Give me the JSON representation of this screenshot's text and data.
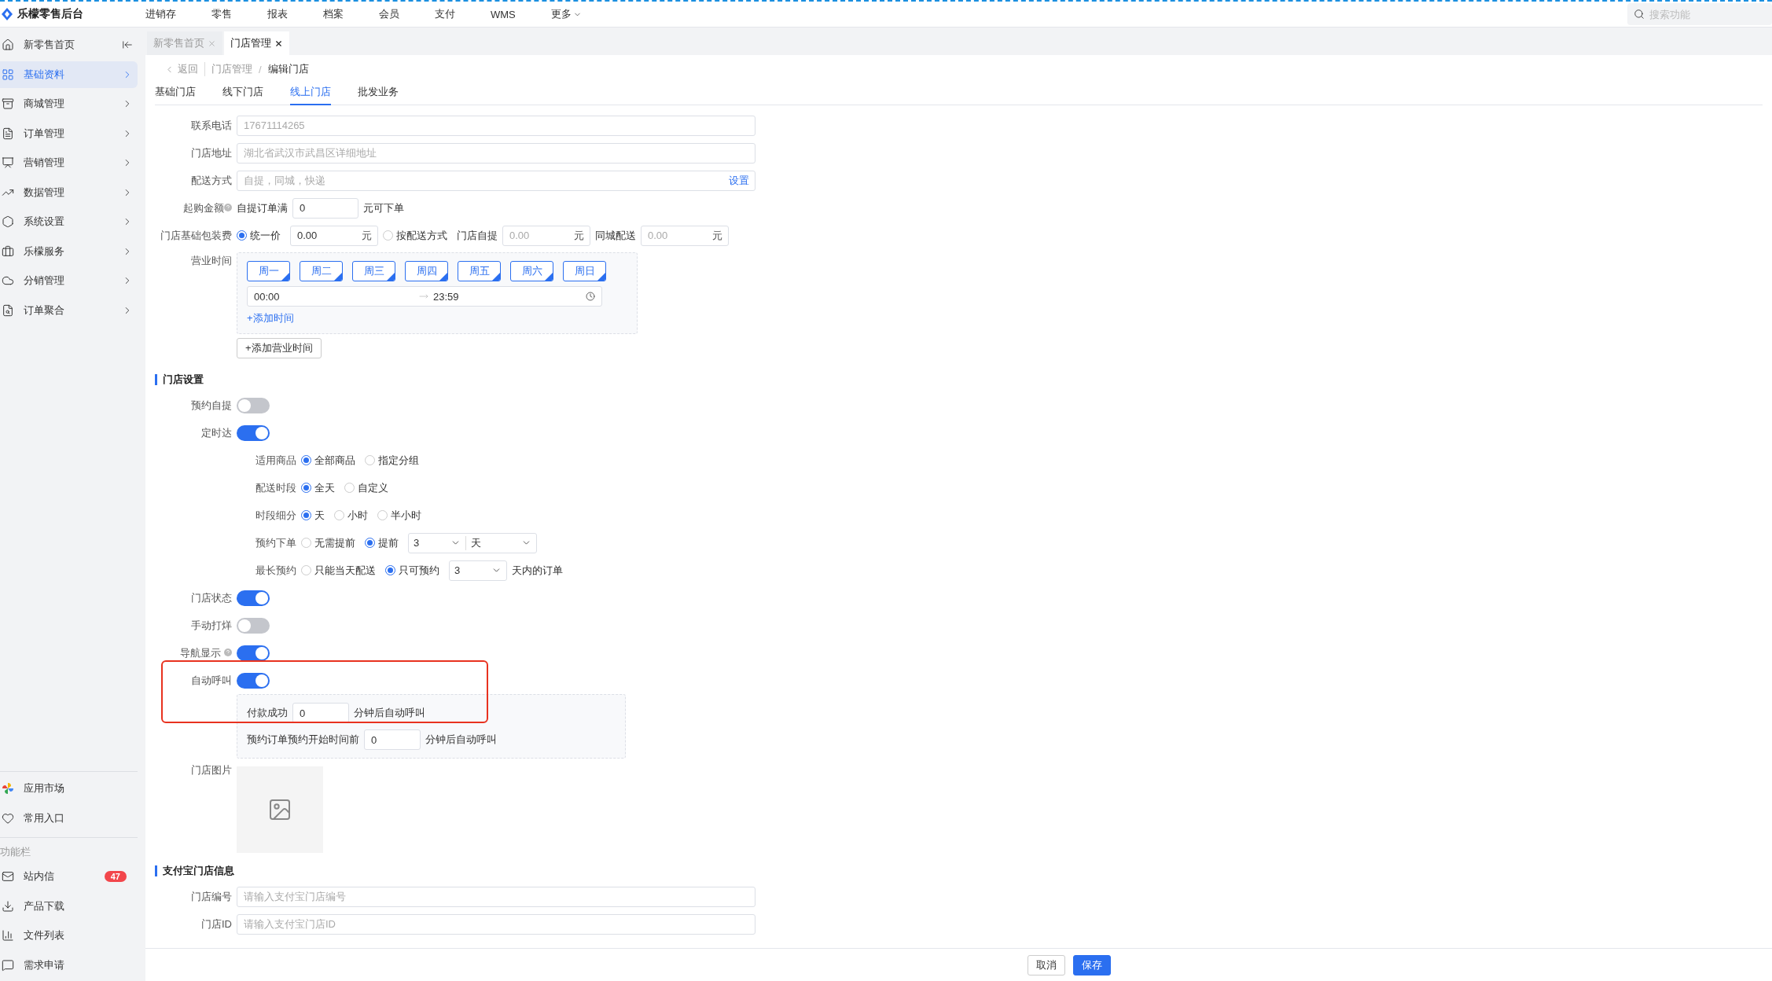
{
  "app": {
    "title": "乐檬零售后台"
  },
  "top_nav": {
    "items": [
      "进销存",
      "零售",
      "报表",
      "档案",
      "会员",
      "支付",
      "WMS"
    ],
    "more": "更多"
  },
  "search": {
    "placeholder": "搜索功能"
  },
  "sidebar": {
    "items": [
      {
        "label": "新零售首页",
        "selected": false
      },
      {
        "label": "基础资料",
        "selected": true
      },
      {
        "label": "商城管理",
        "selected": false
      },
      {
        "label": "订单管理",
        "selected": false
      },
      {
        "label": "营销管理",
        "selected": false
      },
      {
        "label": "数据管理",
        "selected": false
      },
      {
        "label": "系统设置",
        "selected": false
      },
      {
        "label": "乐檬服务",
        "selected": false
      },
      {
        "label": "分销管理",
        "selected": false
      },
      {
        "label": "订单聚合",
        "selected": false
      }
    ],
    "shortcuts": [
      "应用市场",
      "常用入口"
    ],
    "section_title": "功能栏",
    "tools": [
      {
        "label": "站内信",
        "badge": "47"
      },
      {
        "label": "产品下载"
      },
      {
        "label": "文件列表"
      },
      {
        "label": "需求申请"
      }
    ]
  },
  "page_tabs": [
    {
      "label": "新零售首页",
      "selected": false
    },
    {
      "label": "门店管理",
      "selected": true
    }
  ],
  "breadcrumb": {
    "back": "返回",
    "path": [
      "门店管理",
      "编辑门店"
    ],
    "separator": "/"
  },
  "tabs": [
    {
      "label": "基础门店",
      "selected": false
    },
    {
      "label": "线下门店",
      "selected": false
    },
    {
      "label": "线上门店",
      "selected": true
    },
    {
      "label": "批发业务",
      "selected": false
    }
  ],
  "fields": [
    {
      "label": "联系电话",
      "placeholder": "17671114265"
    },
    {
      "label": "门店地址",
      "placeholder": "湖北省武汉市武昌区详细地址"
    },
    {
      "label": "配送方式",
      "placeholder": "自提，同城，快递",
      "action": "设置"
    }
  ],
  "min_purchase": {
    "label": "起购金额",
    "prefix": "自提订单满",
    "value": "0",
    "suffix": "元可下单"
  },
  "packaging_fee": {
    "label": "门店基础包装费",
    "uniform": {
      "label": "统一价",
      "selected": true,
      "value": "0.00",
      "unit": "元"
    },
    "by_delivery": {
      "label": "按配送方式",
      "selected": false,
      "options": [
        {
          "label": "门店自提",
          "placeholder": "0.00",
          "unit": "元"
        },
        {
          "label": "同城配送",
          "placeholder": "0.00",
          "unit": "元"
        }
      ]
    }
  },
  "business_hours": {
    "label": "营业时间",
    "days": [
      {
        "label": "周一",
        "selected": true
      },
      {
        "label": "周二",
        "selected": true
      },
      {
        "label": "周三",
        "selected": true
      },
      {
        "label": "周四",
        "selected": true
      },
      {
        "label": "周五",
        "selected": true
      },
      {
        "label": "周六",
        "selected": true
      },
      {
        "label": "周日",
        "selected": true
      }
    ],
    "start": "00:00",
    "end": "23:59",
    "add_time": "+添加时间",
    "add_hours": "+添加营业时间"
  },
  "store_settings": {
    "title": "门店设置",
    "items": [
      {
        "kind": "switch",
        "label": "预约自提",
        "on": false
      },
      {
        "kind": "switch",
        "label": "定时达",
        "on": true
      },
      {
        "kind": "radio",
        "label": "适用商品",
        "options": [
          {
            "label": "全部商品",
            "selected": true
          },
          {
            "label": "指定分组",
            "selected": false
          }
        ]
      },
      {
        "kind": "radio",
        "label": "配送时段",
        "options": [
          {
            "label": "全天",
            "selected": true
          },
          {
            "label": "自定义",
            "selected": false
          }
        ]
      },
      {
        "kind": "radio",
        "label": "时段细分",
        "options": [
          {
            "label": "天",
            "selected": true
          },
          {
            "label": "小时",
            "selected": false
          },
          {
            "label": "半小时",
            "selected": false
          }
        ]
      },
      {
        "kind": "radio",
        "label": "预约下单",
        "options": [
          {
            "label": "无需提前",
            "selected": false
          },
          {
            "label": "提前",
            "selected": true
          }
        ],
        "selects": [
          "3",
          "天"
        ]
      },
      {
        "kind": "radio",
        "label": "最长预约",
        "options": [
          {
            "label": "只能当天配送",
            "selected": false
          },
          {
            "label": "只可预约",
            "selected": true
          }
        ],
        "selects": [
          "3"
        ],
        "suffix": "天内的订单"
      },
      {
        "kind": "switch",
        "label": "门店状态",
        "on": true
      },
      {
        "kind": "switch",
        "label": "手动打烊",
        "on": false
      },
      {
        "kind": "switch",
        "label": "导航显示",
        "on": true,
        "help": true
      },
      {
        "kind": "switch",
        "label": "自动呼叫",
        "on": true,
        "highlighted": true,
        "panel": [
          {
            "label": "付款成功",
            "value": "0",
            "suffix": "分钟后自动呼叫"
          },
          {
            "label": "预约订单预约开始时间前",
            "value": "0",
            "suffix": "分钟后自动呼叫"
          }
        ]
      }
    ]
  },
  "store_image": {
    "label": "门店图片"
  },
  "alipay": {
    "title": "支付宝门店信息",
    "fields": [
      {
        "label": "门店编号",
        "placeholder": "请输入支付宝门店编号"
      },
      {
        "label": "门店ID",
        "placeholder": "请输入支付宝门店ID"
      }
    ]
  },
  "footer": {
    "buttons": [
      {
        "label": "取消",
        "kind": "default"
      },
      {
        "label": "保存",
        "kind": "primary"
      }
    ]
  }
}
